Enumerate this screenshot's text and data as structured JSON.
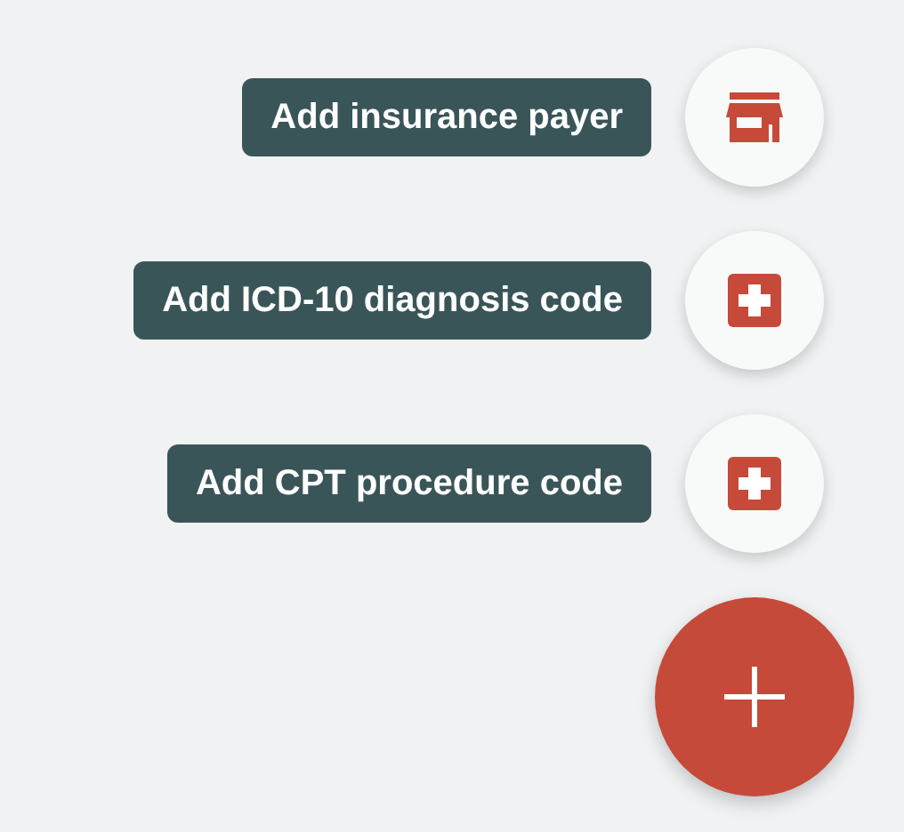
{
  "speed_dial": {
    "actions": [
      {
        "label": "Add insurance payer",
        "kind": "store"
      },
      {
        "label": "Add ICD-10 diagnosis code",
        "kind": "medical"
      },
      {
        "label": "Add CPT procedure code",
        "kind": "medical"
      }
    ]
  }
}
